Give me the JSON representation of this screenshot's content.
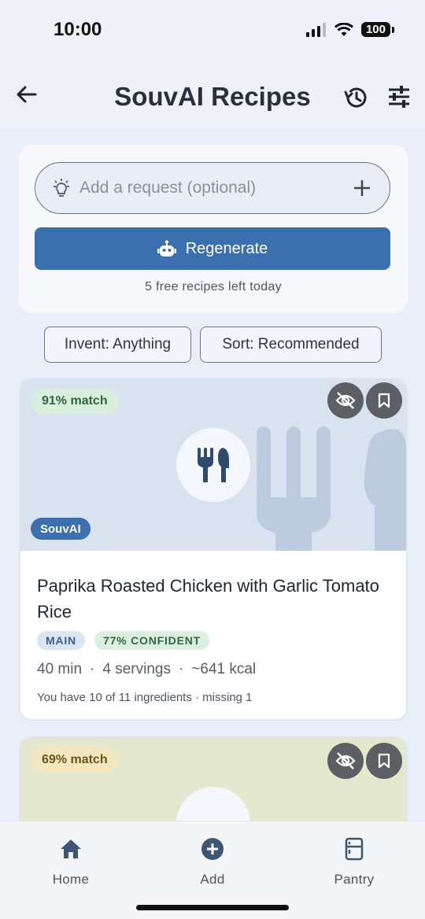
{
  "status_bar": {
    "time": "10:00",
    "battery": "100"
  },
  "header": {
    "title": "SouvAI Recipes"
  },
  "request": {
    "placeholder": "Add a request (optional)",
    "regenerate_label": "Regenerate",
    "free_left": "5 free recipes left today"
  },
  "filters": {
    "invent": "Invent: Anything",
    "sort": "Sort: Recommended"
  },
  "recipes": [
    {
      "match": "91% match",
      "source": "SouvAI",
      "title": "Paprika Roasted Chicken with Garlic Tomato Rice",
      "tags": [
        "MAIN",
        "77% CONFIDENT"
      ],
      "time": "40 min",
      "servings": "4 servings",
      "calories": "~641 kcal",
      "ingredients_line": "You have 10 of 11 ingredients · missing 1",
      "hero_color": "#d9e3f0"
    },
    {
      "match": "69% match",
      "hero_color": "#e3e8cf"
    }
  ],
  "nav": {
    "home": "Home",
    "add": "Add",
    "pantry": "Pantry"
  },
  "colors": {
    "accent": "#3c6fad",
    "icon": "#3e5674"
  }
}
